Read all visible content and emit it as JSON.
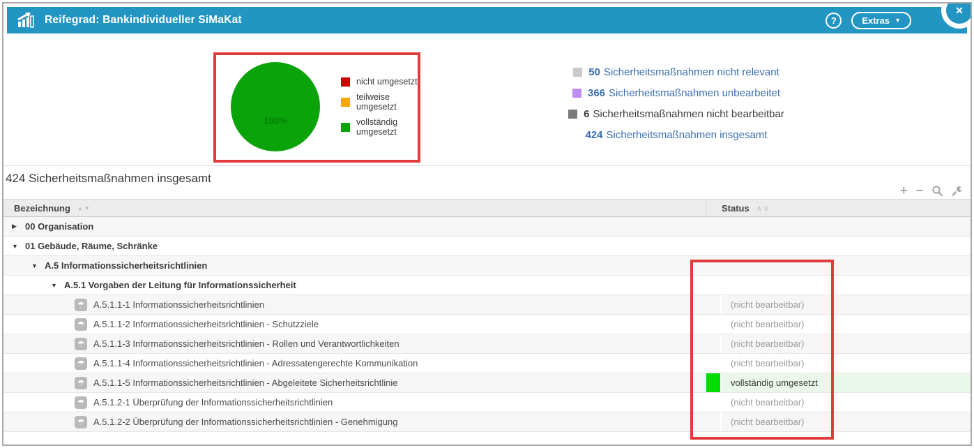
{
  "header": {
    "title": "Reifegrad: Bankindividueller SiMaKat",
    "help_label": "?",
    "extras_label": "Extras",
    "close_label": "✕"
  },
  "colors": {
    "header_bg": "#2295c3",
    "link_blue": "#3e6fb2",
    "annotation_red": "#e23b3b",
    "complete_swatch": "#00dd00",
    "complete_row_bg": "#ecf7ec"
  },
  "chart_data": {
    "type": "pie",
    "title": "",
    "slices": [
      {
        "label": "nicht umgesetzt",
        "value": 0,
        "color": "#cc0000"
      },
      {
        "label": "teilweise umgesetzt",
        "value": 0,
        "color": "#f8a701"
      },
      {
        "label": "vollständig umgesetzt",
        "value": 100,
        "color": "#0aa30a"
      }
    ],
    "data_label": "100%",
    "legend_position": "right"
  },
  "stats": [
    {
      "value": "50",
      "label": "Sicherheitsmaßnahmen nicht relevant",
      "swatch": "#c9c9c9",
      "link": true
    },
    {
      "value": "366",
      "label": "Sicherheitsmaßnahmen unbearbeitet",
      "swatch": "#bd8df2",
      "link": true
    },
    {
      "value": "6",
      "label": "Sicherheitsmaßnahmen nicht bearbeitbar",
      "swatch": "#7a7a7a",
      "link": false
    },
    {
      "value": "424",
      "label": "Sicherheitsmaßnahmen insgesamt",
      "swatch": null,
      "link": true
    }
  ],
  "list": {
    "heading": "424 Sicherheitsmaßnahmen insgesamt"
  },
  "icons": {
    "plus": "+",
    "minus": "−",
    "umbrella": "☂",
    "collapsed": "▶",
    "expanded": "▼",
    "sort_triangles": "▲▼",
    "sort_chevrons": "∧∨",
    "caret_down": "▼"
  },
  "table": {
    "columns": [
      {
        "label": "Bezeichnung"
      },
      {
        "label": "Status"
      }
    ],
    "rows": [
      {
        "type": "group",
        "level": 0,
        "expanded": false,
        "label": "00 Organisation",
        "status": "",
        "status_kind": "none"
      },
      {
        "type": "group",
        "level": 0,
        "expanded": true,
        "label": "01 Gebäude, Räume, Schränke",
        "status": "",
        "status_kind": "none"
      },
      {
        "type": "group",
        "level": 1,
        "expanded": true,
        "label": "A.5 Informationssicherheitsrichtlinien",
        "status": "",
        "status_kind": "none"
      },
      {
        "type": "group",
        "level": 2,
        "expanded": true,
        "label": "A.5.1 Vorgaben der Leitung für Informationssicherheit",
        "status": "",
        "status_kind": "none"
      },
      {
        "type": "leaf",
        "level": 3,
        "label": "A.5.1.1-1 Informationssicherheitsrichtlinien",
        "status": "(nicht bearbeitbar)",
        "status_kind": "disabled"
      },
      {
        "type": "leaf",
        "level": 3,
        "label": "A.5.1.1-2 Informationssicherheitsrichtlinien - Schutzziele",
        "status": "(nicht bearbeitbar)",
        "status_kind": "disabled"
      },
      {
        "type": "leaf",
        "level": 3,
        "label": "A.5.1.1-3 Informationssicherheitsrichtlinien - Rollen und Verantwortlichkeiten",
        "status": "(nicht bearbeitbar)",
        "status_kind": "disabled"
      },
      {
        "type": "leaf",
        "level": 3,
        "label": "A.5.1.1-4 Informationssicherheitsrichtlinien - Adressatengerechte Kommunikation",
        "status": "(nicht bearbeitbar)",
        "status_kind": "disabled"
      },
      {
        "type": "leaf",
        "level": 3,
        "label": "A.5.1.1-5 Informationssicherheitsrichtlinien - Abgeleitete Sicherheitsrichtlinie",
        "status": "vollständig umgesetzt",
        "status_kind": "complete"
      },
      {
        "type": "leaf",
        "level": 3,
        "label": "A.5.1.2-1 Überprüfung der Informationssicherheitsrichtlinien",
        "status": "(nicht bearbeitbar)",
        "status_kind": "disabled"
      },
      {
        "type": "leaf",
        "level": 3,
        "label": "A.5.1.2-2 Überprüfung der Informationssicherheitsrichtlinien - Genehmigung",
        "status": "(nicht bearbeitbar)",
        "status_kind": "disabled"
      }
    ]
  }
}
